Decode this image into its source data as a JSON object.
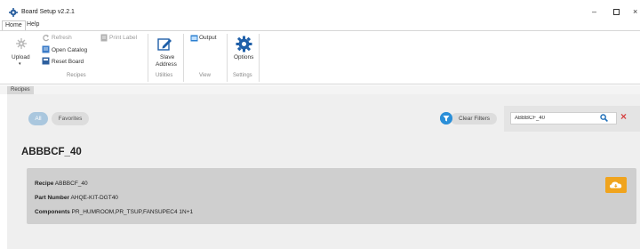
{
  "window": {
    "title": "Board Setup v2.2.1",
    "minimize_glyph": "–",
    "close_glyph": "×"
  },
  "menu": {
    "home": "Home",
    "help": "Help"
  },
  "ribbon": {
    "upload": "Upload",
    "upload_caret": "▾",
    "refresh": "Refresh",
    "print_label": "Print Label",
    "open_catalog": "Open Catalog",
    "reset_board": "Reset Board",
    "recipes_group": "Recipes",
    "slave_address_line1": "Slave",
    "slave_address_line2": "Address",
    "utilities_group": "Utilities",
    "output": "Output",
    "view_group": "View",
    "options": "Options",
    "settings_group": "Settings"
  },
  "tabs": {
    "recipes": "Recipes"
  },
  "filters": {
    "all": "All",
    "favorites": "Favorites",
    "clear_filters": "Clear Filters"
  },
  "search": {
    "value": "ABBBCF_40"
  },
  "group_title": "ABBBCF_40",
  "card": {
    "recipe_label": "Recipe",
    "recipe_value": "ABBBCF_40",
    "part_label": "Part Number",
    "part_value": "AHQE-KIT-DGT40",
    "components_label": "Components",
    "components_value": "PR_HUMROOM,PR_TSUP,FANSUPEC4 1N+1"
  },
  "colors": {
    "accent_blue": "#2b8fd8",
    "pill_active": "#aac7de",
    "clear_red": "#d64545",
    "cloud_orange": "#f0a41e",
    "card_gray": "#cfcfcf"
  },
  "icons": {
    "app": "gear-icon",
    "upload": "upload-icon",
    "refresh": "refresh-icon",
    "print_label": "printer-icon",
    "open_catalog": "catalog-icon",
    "reset_board": "reset-icon",
    "slave_address": "edit-icon",
    "output": "output-icon",
    "options": "gear-icon",
    "filter": "filter-icon",
    "search": "search-icon",
    "clear": "close-icon",
    "cloud": "cloud-download-icon"
  }
}
